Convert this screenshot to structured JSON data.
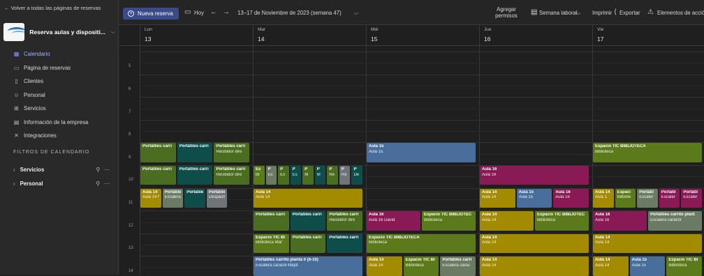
{
  "sidebar": {
    "back_link": "← Volver a todas las páginas de reservas",
    "business_name": "Reserva aulas y dispositi...",
    "nav": [
      {
        "label": "Calendario",
        "icon": "calendar-icon",
        "active": true
      },
      {
        "label": "Página de reservas",
        "icon": "monitor-icon"
      },
      {
        "label": "Clientes",
        "icon": "contact-card-icon"
      },
      {
        "label": "Personal",
        "icon": "people-icon"
      },
      {
        "label": "Servicios",
        "icon": "services-icon"
      },
      {
        "label": "Información de la empresa",
        "icon": "building-icon"
      },
      {
        "label": "Integraciones",
        "icon": "integrations-icon"
      }
    ],
    "filters_title": "FILTROS DE CALENDARIO",
    "filters": [
      {
        "label": "Servicios"
      },
      {
        "label": "Personal"
      }
    ]
  },
  "toolbar": {
    "new_booking": "Nueva reserva",
    "today": "Hoy",
    "date_range": "13–17 de Noviembre de 2023 (semana 47)",
    "add_permissions": "Agregar permisos",
    "work_week": "Semana laboral",
    "print": "Imprimir",
    "export": "Exportar",
    "items": "Elementos de acció"
  },
  "days": [
    {
      "name": "Lun",
      "num": "13"
    },
    {
      "name": "Mar",
      "num": "14"
    },
    {
      "name": "Mié",
      "num": "15"
    },
    {
      "name": "Jue",
      "num": "16"
    },
    {
      "name": "Vie",
      "num": "17"
    }
  ],
  "hours": [
    "5",
    "6",
    "7",
    "8",
    "9",
    "10",
    "11",
    "12",
    "13",
    "14"
  ],
  "colors": {
    "green": "#4a6d1f",
    "teal": "#0f4d4a",
    "yellow": "#a38b00",
    "blue": "#4a6e9c",
    "purple": "#8a1a55",
    "sage": "#6b7b63",
    "slate": "#6d7376",
    "olive": "#5b7a1a"
  },
  "events": [
    {
      "day": 0,
      "start": 9.0,
      "end": 9.9,
      "lane": 0,
      "lanes": 3,
      "color": "green",
      "title": "Portátiles carri",
      "sub": ""
    },
    {
      "day": 0,
      "start": 9.0,
      "end": 9.9,
      "lane": 1,
      "lanes": 3,
      "color": "teal",
      "title": "Portátiles carri",
      "sub": ""
    },
    {
      "day": 0,
      "start": 9.0,
      "end": 9.9,
      "lane": 2,
      "lanes": 3,
      "color": "green",
      "title": "Portátiles carri",
      "sub": "Recibidor dire"
    },
    {
      "day": 0,
      "start": 10.0,
      "end": 10.9,
      "lane": 0,
      "lanes": 3,
      "color": "green",
      "title": "Portátiles carri",
      "sub": ""
    },
    {
      "day": 0,
      "start": 10.0,
      "end": 10.9,
      "lane": 1,
      "lanes": 3,
      "color": "teal",
      "title": "Portátiles carri",
      "sub": ""
    },
    {
      "day": 0,
      "start": 10.0,
      "end": 10.9,
      "lane": 2,
      "lanes": 3,
      "color": "green",
      "title": "Portátiles carri",
      "sub": "Recibidor dire"
    },
    {
      "day": 0,
      "start": 11.0,
      "end": 11.9,
      "lane": 0,
      "lanes": 5,
      "color": "yellow",
      "title": "Aula 14",
      "sub": "Aula 14 N"
    },
    {
      "day": 0,
      "start": 11.0,
      "end": 11.9,
      "lane": 1,
      "lanes": 5,
      "color": "sage",
      "title": "Portátiles",
      "sub": "Escalera c"
    },
    {
      "day": 0,
      "start": 11.0,
      "end": 11.9,
      "lane": 2,
      "lanes": 5,
      "color": "teal",
      "title": "Portátiles",
      "sub": ""
    },
    {
      "day": 0,
      "start": 11.0,
      "end": 11.9,
      "lane": 3,
      "lanes": 5,
      "color": "slate",
      "title": "Portátiles",
      "sub": "Despacho"
    },
    {
      "day": 1,
      "start": 10.0,
      "end": 10.9,
      "lane": 0,
      "lanes": 9,
      "color": "olive",
      "title": "Es",
      "sub": "Bi"
    },
    {
      "day": 1,
      "start": 10.0,
      "end": 10.9,
      "lane": 1,
      "lanes": 9,
      "color": "sage",
      "title": "P",
      "sub": "Es"
    },
    {
      "day": 1,
      "start": 10.0,
      "end": 10.9,
      "lane": 2,
      "lanes": 9,
      "color": "green",
      "title": "P",
      "sub": "Es"
    },
    {
      "day": 1,
      "start": 10.0,
      "end": 10.9,
      "lane": 3,
      "lanes": 9,
      "color": "teal",
      "title": "P",
      "sub": "Es"
    },
    {
      "day": 1,
      "start": 10.0,
      "end": 10.9,
      "lane": 4,
      "lanes": 9,
      "color": "green",
      "title": "P",
      "sub": "M"
    },
    {
      "day": 1,
      "start": 10.0,
      "end": 10.9,
      "lane": 5,
      "lanes": 9,
      "color": "teal",
      "title": "P",
      "sub": "M"
    },
    {
      "day": 1,
      "start": 10.0,
      "end": 10.9,
      "lane": 6,
      "lanes": 9,
      "color": "green",
      "title": "P",
      "sub": "Re"
    },
    {
      "day": 1,
      "start": 10.0,
      "end": 10.9,
      "lane": 7,
      "lanes": 9,
      "color": "slate",
      "title": "P",
      "sub": "Re"
    },
    {
      "day": 1,
      "start": 10.0,
      "end": 10.9,
      "lane": 8,
      "lanes": 9,
      "color": "teal",
      "title": "P",
      "sub": "De"
    },
    {
      "day": 1,
      "start": 11.0,
      "end": 11.9,
      "lane": 0,
      "lanes": 1,
      "color": "yellow",
      "title": "Aula 14",
      "sub": "Aula 14"
    },
    {
      "day": 1,
      "start": 12.0,
      "end": 12.9,
      "lane": 0,
      "lanes": 3,
      "color": "green",
      "title": "Portátiles carri",
      "sub": ""
    },
    {
      "day": 1,
      "start": 12.0,
      "end": 12.9,
      "lane": 1,
      "lanes": 3,
      "color": "teal",
      "title": "Portátiles carri",
      "sub": ""
    },
    {
      "day": 1,
      "start": 12.0,
      "end": 12.9,
      "lane": 2,
      "lanes": 3,
      "color": "green",
      "title": "Portátiles carri",
      "sub": "Recibidor dire"
    },
    {
      "day": 1,
      "start": 13.0,
      "end": 13.9,
      "lane": 0,
      "lanes": 3,
      "color": "olive",
      "title": "Espacio TIC BI",
      "sub": "Biblioteca Mar"
    },
    {
      "day": 1,
      "start": 13.0,
      "end": 13.9,
      "lane": 1,
      "lanes": 3,
      "color": "green",
      "title": "Portátiles carri",
      "sub": ""
    },
    {
      "day": 1,
      "start": 13.0,
      "end": 13.9,
      "lane": 2,
      "lanes": 3,
      "color": "teal",
      "title": "Portátiles carri",
      "sub": ""
    },
    {
      "day": 1,
      "start": 14.0,
      "end": 14.9,
      "lane": 0,
      "lanes": 1,
      "color": "blue",
      "title": "Portátiles carrito planta 0 (6-10)",
      "sub": "Escalera caracol Maytr"
    },
    {
      "day": 2,
      "start": 9.0,
      "end": 9.9,
      "lane": 0,
      "lanes": 1,
      "color": "blue",
      "title": "Aula 15",
      "sub": "Aula 15"
    },
    {
      "day": 2,
      "start": 12.0,
      "end": 12.9,
      "lane": 0,
      "lanes": 2,
      "color": "purple",
      "title": "Aula 16",
      "sub": "Aula 16 David"
    },
    {
      "day": 2,
      "start": 12.0,
      "end": 12.9,
      "lane": 1,
      "lanes": 2,
      "color": "olive",
      "title": "Espacio TIC BIBLIOTEC",
      "sub": "Biblioteca"
    },
    {
      "day": 2,
      "start": 13.0,
      "end": 13.9,
      "lane": 0,
      "lanes": 1,
      "color": "olive",
      "title": "Espacio TIC BIBLIOTECA",
      "sub": "Biblioteca"
    },
    {
      "day": 2,
      "start": 14.0,
      "end": 14.9,
      "lane": 0,
      "lanes": 3,
      "color": "yellow",
      "title": "Aula 14",
      "sub": "Aula 14"
    },
    {
      "day": 2,
      "start": 14.0,
      "end": 14.9,
      "lane": 1,
      "lanes": 3,
      "color": "olive",
      "title": "Espacio TIC BI",
      "sub": "Biblioteca"
    },
    {
      "day": 2,
      "start": 14.0,
      "end": 14.9,
      "lane": 2,
      "lanes": 3,
      "color": "sage",
      "title": "Portátiles carri",
      "sub": "Escalera carac"
    },
    {
      "day": 3,
      "start": 10.0,
      "end": 10.9,
      "lane": 0,
      "lanes": 1,
      "color": "purple",
      "title": "Aula 16",
      "sub": "Aula 16"
    },
    {
      "day": 3,
      "start": 11.0,
      "end": 11.9,
      "lane": 0,
      "lanes": 3,
      "color": "yellow",
      "title": "Aula 14",
      "sub": "Aula 14"
    },
    {
      "day": 3,
      "start": 11.0,
      "end": 11.9,
      "lane": 1,
      "lanes": 3,
      "color": "blue",
      "title": "Aula 15",
      "sub": "Aula 15"
    },
    {
      "day": 3,
      "start": 11.0,
      "end": 11.9,
      "lane": 2,
      "lanes": 3,
      "color": "purple",
      "title": "Aula 16",
      "sub": "Aula 16"
    },
    {
      "day": 3,
      "start": 12.0,
      "end": 12.9,
      "lane": 0,
      "lanes": 2,
      "color": "yellow",
      "title": "Aula 14",
      "sub": "Aula 14"
    },
    {
      "day": 3,
      "start": 12.0,
      "end": 12.9,
      "lane": 1,
      "lanes": 2,
      "color": "olive",
      "title": "Espacio TIC BIBLIOTEC",
      "sub": "Biblioteca"
    },
    {
      "day": 3,
      "start": 13.0,
      "end": 13.9,
      "lane": 0,
      "lanes": 1,
      "color": "yellow",
      "title": "Aula 14",
      "sub": "Aula 14"
    },
    {
      "day": 3,
      "start": 14.0,
      "end": 14.9,
      "lane": 0,
      "lanes": 1,
      "color": "yellow",
      "title": "Aula 14",
      "sub": "Aula 14"
    },
    {
      "day": 4,
      "start": 9.0,
      "end": 9.9,
      "lane": 0,
      "lanes": 1,
      "color": "olive",
      "title": "Espacio TIC BIBLIOTECA",
      "sub": "Biblioteca"
    },
    {
      "day": 4,
      "start": 11.0,
      "end": 11.9,
      "lane": 0,
      "lanes": 5,
      "color": "yellow",
      "title": "Aula 14",
      "sub": "Aula 1"
    },
    {
      "day": 4,
      "start": 11.0,
      "end": 11.9,
      "lane": 1,
      "lanes": 5,
      "color": "olive",
      "title": "Espaci",
      "sub": "Bibliote"
    },
    {
      "day": 4,
      "start": 11.0,
      "end": 11.9,
      "lane": 2,
      "lanes": 5,
      "color": "sage",
      "title": "Portátil",
      "sub": "Escaler"
    },
    {
      "day": 4,
      "start": 11.0,
      "end": 11.9,
      "lane": 3,
      "lanes": 5,
      "color": "purple",
      "title": "Portátil",
      "sub": "Escaler"
    },
    {
      "day": 4,
      "start": 11.0,
      "end": 11.9,
      "lane": 4,
      "lanes": 5,
      "color": "purple",
      "title": "Portátil",
      "sub": "Escaler"
    },
    {
      "day": 4,
      "start": 12.0,
      "end": 12.9,
      "lane": 0,
      "lanes": 2,
      "color": "purple",
      "title": "Aula 16",
      "sub": "Aula 16"
    },
    {
      "day": 4,
      "start": 12.0,
      "end": 12.9,
      "lane": 1,
      "lanes": 2,
      "color": "sage",
      "title": "Portátiles carrito plant",
      "sub": "Escalera caracol"
    },
    {
      "day": 4,
      "start": 13.0,
      "end": 13.9,
      "lane": 0,
      "lanes": 1,
      "color": "yellow",
      "title": "Aula 14",
      "sub": "Aula 14"
    },
    {
      "day": 4,
      "start": 14.0,
      "end": 14.9,
      "lane": 0,
      "lanes": 3,
      "color": "yellow",
      "title": "Aula 14",
      "sub": "Aula 14"
    },
    {
      "day": 4,
      "start": 14.0,
      "end": 14.9,
      "lane": 1,
      "lanes": 3,
      "color": "blue",
      "title": "Aula 15",
      "sub": "Aula 15"
    },
    {
      "day": 4,
      "start": 14.0,
      "end": 14.9,
      "lane": 2,
      "lanes": 3,
      "color": "olive",
      "title": "Espacio TIC BI",
      "sub": "Biblioteca"
    }
  ]
}
